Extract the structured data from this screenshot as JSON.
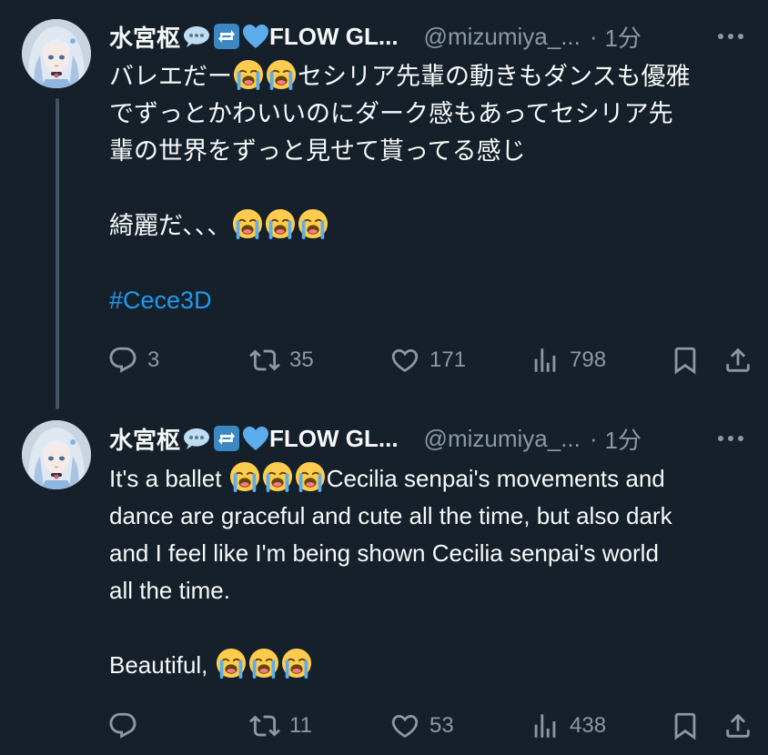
{
  "colors": {
    "background": "#15202b",
    "text": "#f7f9f9",
    "muted": "#8b98a5",
    "hashtag": "#1d9bf0",
    "thread_line": "#425364"
  },
  "tweets": [
    {
      "author": {
        "name": "水宮枢",
        "name_suffix": "FLOW GL...",
        "handle": "@mizumiya_...",
        "badges": [
          "speech-bubble-emoji",
          "repeat-emoji",
          "blue-heart-emoji"
        ]
      },
      "separator": "·",
      "time": "1分",
      "lines": [
        "バレエだー",
        "セシリア先輩の動きもダンスも優雅",
        "でずっとかわいいのにダーク感もあってセシリア先",
        "輩の世界をずっと見せて貰ってる感じ",
        "綺麗だ、、、"
      ],
      "hashtag": "#Cece3D",
      "stats": {
        "replies": "3",
        "retweets": "35",
        "likes": "171",
        "views": "798"
      }
    },
    {
      "author": {
        "name": "水宮枢",
        "name_suffix": "FLOW GL...",
        "handle": "@mizumiya_...",
        "badges": [
          "speech-bubble-emoji",
          "repeat-emoji",
          "blue-heart-emoji"
        ]
      },
      "separator": "·",
      "time": "1分",
      "lines": [
        "It's a ballet ",
        "Cecilia senpai's movements and",
        "dance are graceful and cute all the time, but also dark",
        "and I feel like I'm being shown Cecilia senpai's world",
        "all the time.",
        "Beautiful, "
      ],
      "stats": {
        "replies": "",
        "retweets": "11",
        "likes": "53",
        "views": "438"
      }
    }
  ]
}
